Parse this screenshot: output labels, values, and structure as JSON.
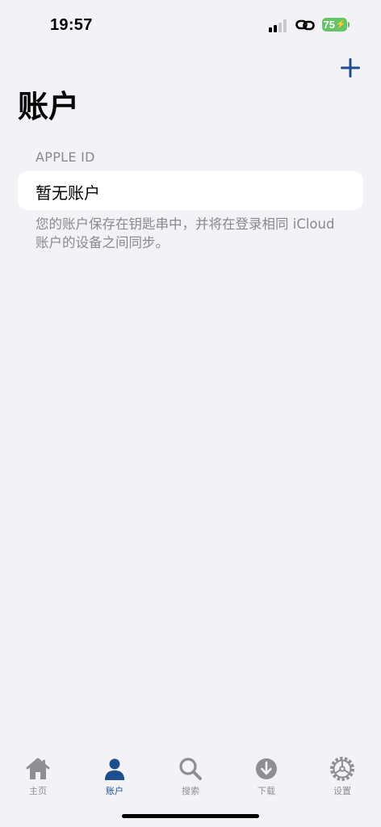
{
  "status_bar": {
    "time": "19:57",
    "battery": "75"
  },
  "header": {
    "add_icon": "plus-icon",
    "title": "账户"
  },
  "section": {
    "header": "APPLE ID",
    "empty_label": "暂无账户",
    "footer": "您的账户保存在钥匙串中，并将在登录相同 iCloud 账户的设备之间同步。"
  },
  "tabs": [
    {
      "label": "主页",
      "icon": "house-icon",
      "active": false
    },
    {
      "label": "账户",
      "icon": "person-icon",
      "active": true
    },
    {
      "label": "搜索",
      "icon": "magnifier-icon",
      "active": false
    },
    {
      "label": "下载",
      "icon": "download-icon",
      "active": false
    },
    {
      "label": "设置",
      "icon": "gear-icon",
      "active": false
    }
  ],
  "colors": {
    "accent": "#1f4e8f",
    "inactive": "#8e8e93",
    "background": "#f2f2f7",
    "battery": "#65c466"
  }
}
